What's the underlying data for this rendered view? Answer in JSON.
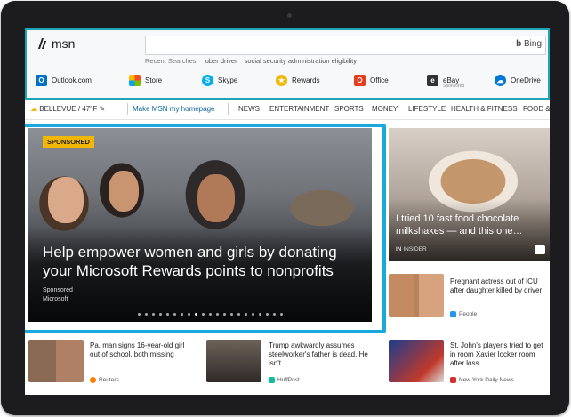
{
  "header": {
    "brand": "msn",
    "search_engine": "Bing",
    "recent_label": "Recent Searches:",
    "recent": [
      "uber driver",
      "social security administration eligibility"
    ]
  },
  "quick_links": [
    {
      "label": "Outlook.com",
      "icon": "outlook-icon",
      "color": "#0072c6"
    },
    {
      "label": "Store",
      "icon": "store-icon",
      "color": "#f25022"
    },
    {
      "label": "Skype",
      "icon": "skype-icon",
      "color": "#00aff0"
    },
    {
      "label": "Rewards",
      "icon": "rewards-icon",
      "color": "#f2b705"
    },
    {
      "label": "Office",
      "icon": "office-icon",
      "color": "#e43e1c"
    },
    {
      "label": "eBay",
      "sub": "Sponsored",
      "icon": "ebay-icon",
      "color": "#333333"
    },
    {
      "label": "OneDrive",
      "icon": "onedrive-icon",
      "color": "#0078d4"
    }
  ],
  "nav": {
    "weather": "BELLEVUE / 47°F",
    "make_home": "Make MSN my homepage",
    "items": [
      "NEWS",
      "ENTERTAINMENT",
      "SPORTS",
      "MONEY",
      "LIFESTYLE",
      "HEALTH & FITNESS",
      "FOOD &"
    ]
  },
  "hero": {
    "badge": "SPONSORED",
    "title": "Help empower women and girls by donating your Microsoft Rewards points to nonprofits",
    "sponsored": "Sponsored",
    "source": "Microsoft",
    "dots_total": 21,
    "active_dot": 8
  },
  "side_story": {
    "title": "I tried 10 fast food chocolate milkshakes — and this one…",
    "source": "INSIDER"
  },
  "cards": [
    {
      "title": "Pregnant actress out of ICU after daughter killed by driver",
      "source": "People",
      "src_color": "#2196f3"
    },
    {
      "title": "Pa. man signs 16-year-old girl out of school, both missing",
      "source": "Reuters",
      "src_color": "#ff8000"
    },
    {
      "title": "Trump awkwardly assumes steelworker's father is dead. He isn't.",
      "source": "HuffPost",
      "src_color": "#0dbe98"
    },
    {
      "title": "St. John's player's tried to get in room Xavier locker room after loss",
      "source": "New York Daily News",
      "src_color": "#d32f2f"
    }
  ],
  "colors": {
    "accent": "#18a8dc",
    "header_border": "#1aa6b7",
    "badge": "#f2b705",
    "nav_link": "#0a64a0"
  }
}
